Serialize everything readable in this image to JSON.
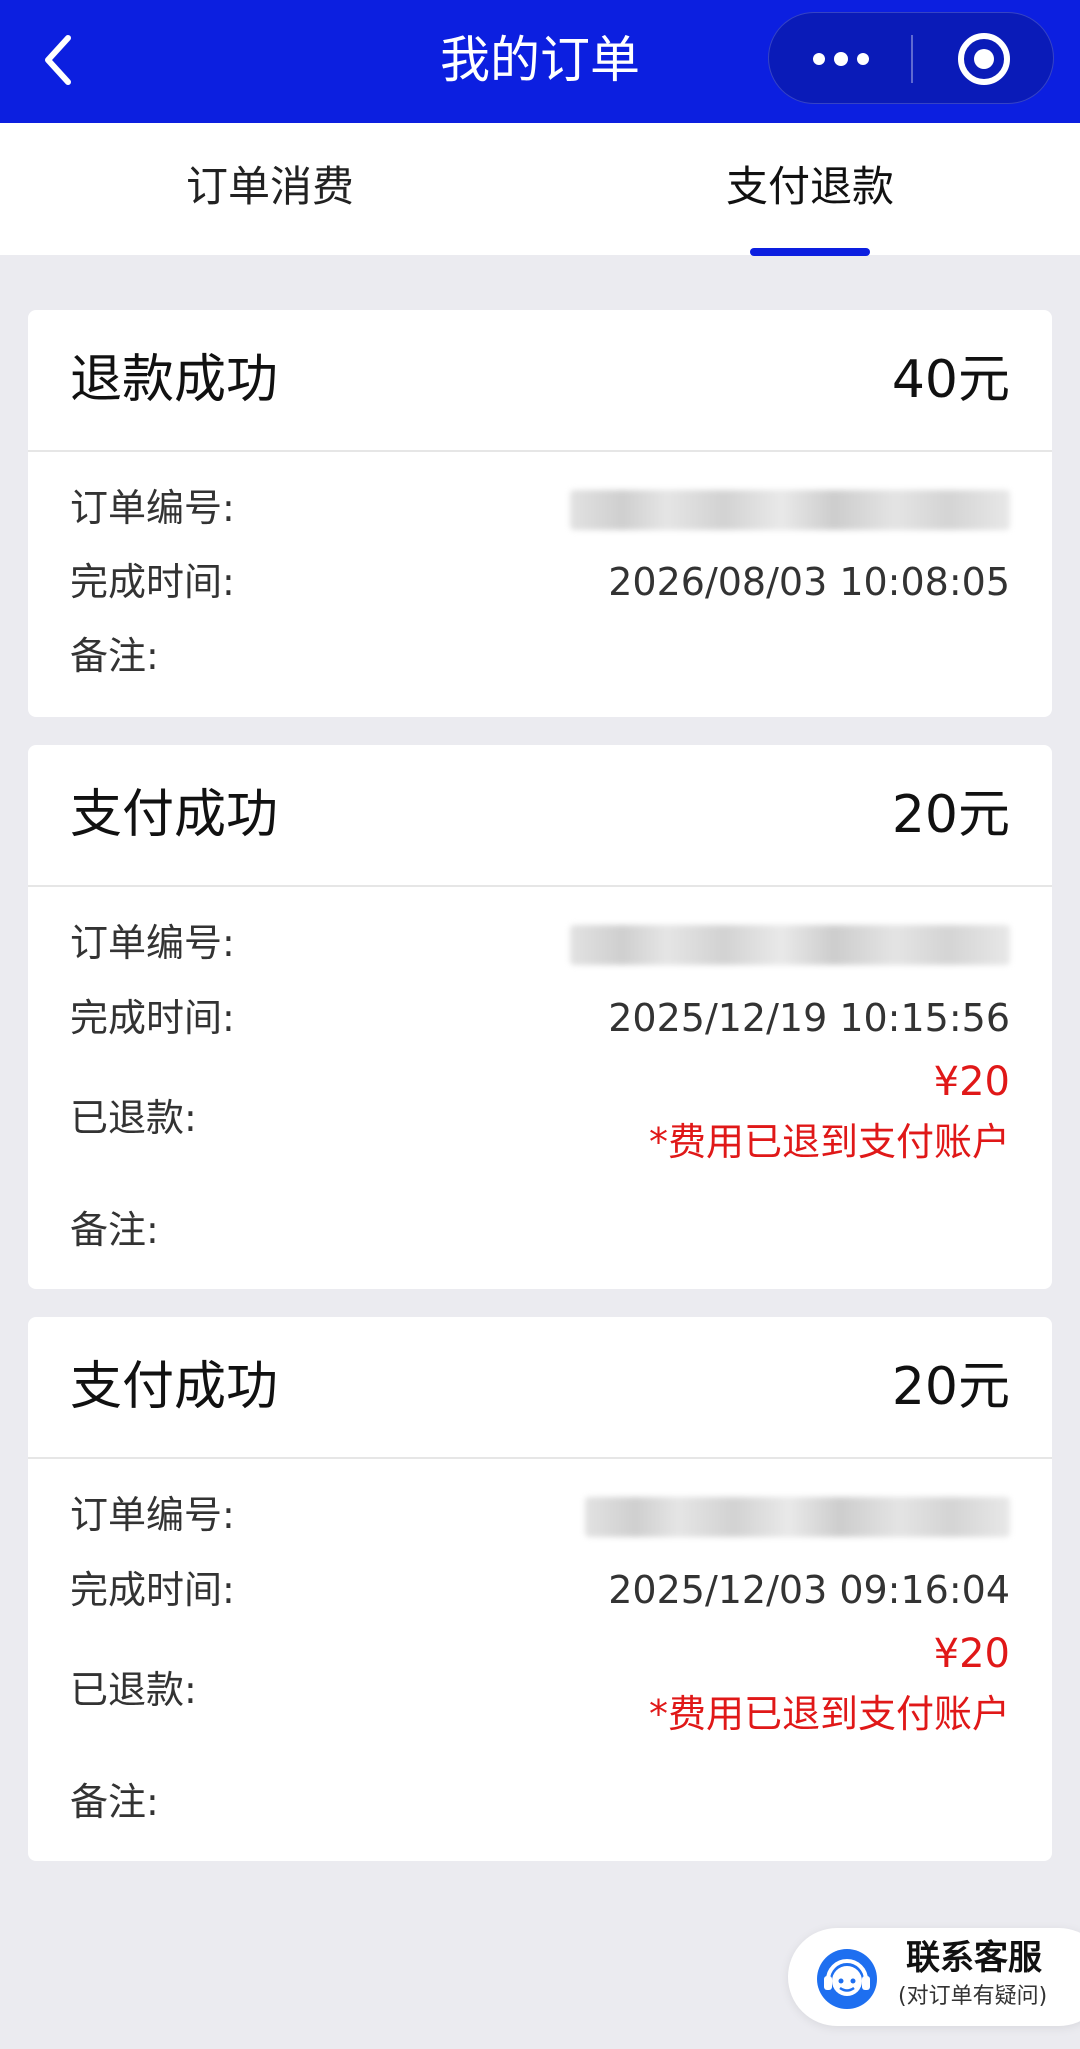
{
  "header": {
    "title": "我的订单"
  },
  "tabs": [
    "订单消费",
    "支付退款"
  ],
  "active_tab_index": 1,
  "labels": {
    "order_no": "订单编号:",
    "finish_time": "完成时间:",
    "refunded": "已退款:",
    "remark": "备注:"
  },
  "orders": [
    {
      "status": "退款成功",
      "amount": "40元",
      "finish_time": "2026/08/03 10:08:05"
    },
    {
      "status": "支付成功",
      "amount": "20元",
      "finish_time": "2025/12/19 10:15:56",
      "refund_amount": "¥20",
      "refund_note": "*费用已退到支付账户"
    },
    {
      "status": "支付成功",
      "amount": "20元",
      "finish_time": "2025/12/03 09:16:04",
      "refund_amount": "¥20",
      "refund_note": "*费用已退到支付账户"
    }
  ],
  "contact": {
    "title": "联系客服",
    "subtitle": "(对订单有疑问)"
  },
  "colors": {
    "brand": "#0c1fe0",
    "refund": "#e01818",
    "background": "#ebebf0"
  }
}
